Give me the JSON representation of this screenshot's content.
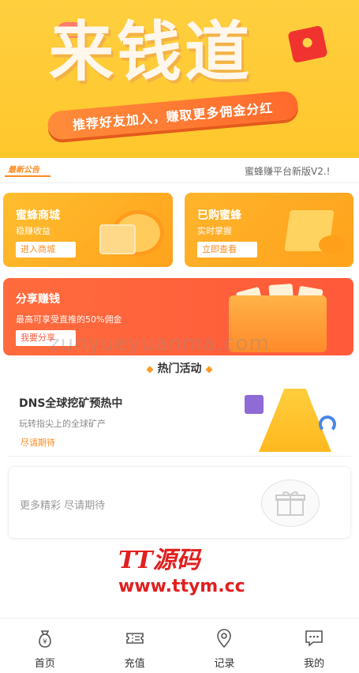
{
  "banner": {
    "title": "来钱道",
    "slogan": "推荐好友加入，赚取更多佣金分红"
  },
  "notice": {
    "badge": "最新公告",
    "text": "蜜蜂赚平台新版V2.!"
  },
  "cards": {
    "shop": {
      "title": "蜜蜂商城",
      "subtitle": "稳赚收益",
      "button": "进入商城"
    },
    "bee": {
      "title": "已购蜜蜂",
      "subtitle": "实时掌握",
      "button": "立即查看"
    },
    "share": {
      "title": "分享赚钱",
      "subtitle": "最高可享受直推的50%佣金",
      "button": "我要分享"
    }
  },
  "watermark": "zunyueyuanma.com",
  "hot": {
    "title": "热门活动"
  },
  "event": {
    "title": "DNS全球挖矿预热中",
    "subtitle": "玩转指尖上的全球矿产",
    "status": "尽请期待"
  },
  "more": {
    "text": "更多精彩 尽请期待"
  },
  "brand": {
    "logo": "TT源码",
    "url": "www.ttym.cc"
  },
  "tabbar": {
    "items": [
      {
        "label": "首页",
        "icon": "money-bag-icon"
      },
      {
        "label": "充值",
        "icon": "ticket-icon"
      },
      {
        "label": "记录",
        "icon": "location-icon"
      },
      {
        "label": "我的",
        "icon": "chat-icon"
      }
    ]
  },
  "colors": {
    "banner": "#ffc72c",
    "accent": "#ff8a1f",
    "share": "#ff5a3a",
    "brand": "#e21f1f"
  }
}
